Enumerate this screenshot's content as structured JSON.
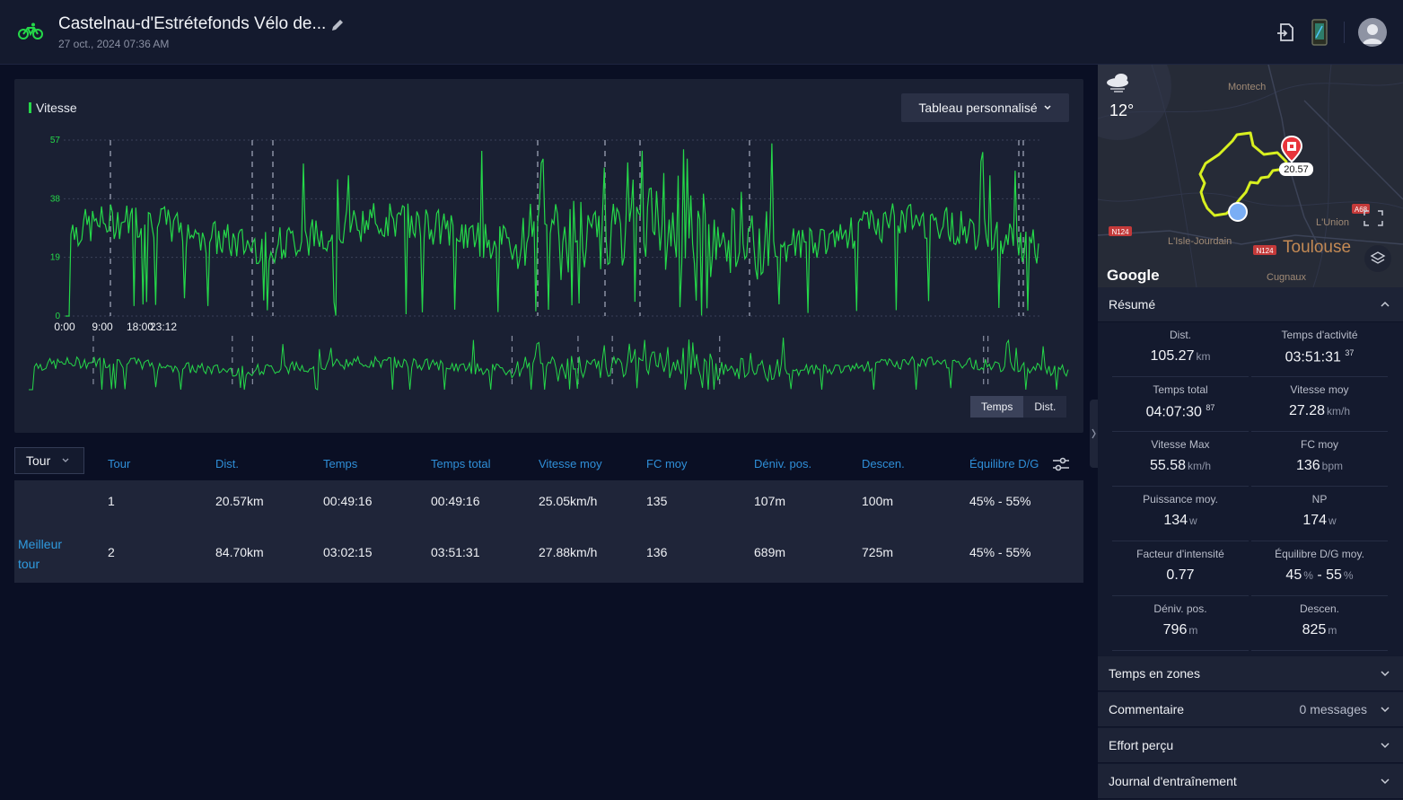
{
  "header": {
    "title": "Castelnau-d'Estrétefonds Vélo de...",
    "date": "27 oct., 2024 07:36 AM"
  },
  "chart": {
    "legend": "Vitesse",
    "custom_table_label": "Tableau personnalisé",
    "toggle": [
      "Temps",
      "Dist."
    ],
    "colors": {
      "line": "#25d849",
      "background": "#1a2033"
    }
  },
  "chart_data": {
    "type": "line",
    "series": [
      {
        "name": "Vitesse",
        "unit": "km/h"
      }
    ],
    "ylim": [
      0,
      57
    ],
    "yticks": [
      "57",
      "38",
      "19",
      "0"
    ],
    "xticks": [
      "0:00",
      "9:00",
      "18:00",
      "23:12"
    ],
    "grid": true,
    "legend_position": "top-left"
  },
  "laps": {
    "select_label": "Tour",
    "headers": [
      "Tour",
      "Dist.",
      "Temps",
      "Temps total",
      "Vitesse moy",
      "FC moy",
      "Déniv. pos.",
      "Descen.",
      "Équilibre D/G"
    ],
    "best_lap_label": "Meilleur tour",
    "rows": [
      [
        "1",
        "20.57km",
        "00:49:16",
        "00:49:16",
        "25.05km/h",
        "135",
        "107m",
        "100m",
        "45% - 55%"
      ],
      [
        "2",
        "84.70km",
        "03:02:15",
        "03:51:31",
        "27.88km/h",
        "136",
        "689m",
        "725m",
        "45% - 55%"
      ]
    ]
  },
  "map": {
    "temperature": "12°",
    "distance_marker": "20.57",
    "places": [
      "Montech",
      "L'Union",
      "L'Isle-Jourdain",
      "Toulouse",
      "Cugnaux"
    ],
    "roads": [
      "N124",
      "N124",
      "A68"
    ],
    "attribution": "Google"
  },
  "summary": {
    "title": "Résumé",
    "stats": [
      {
        "label": "Dist.",
        "value": "105.27",
        "unit": "km",
        "sup": ""
      },
      {
        "label": "Temps d'activité",
        "value": "03:51:31",
        "unit": "",
        "sup": "37"
      },
      {
        "label": "Temps total",
        "value": "04:07:30",
        "unit": "",
        "sup": "87"
      },
      {
        "label": "Vitesse moy",
        "value": "27.28",
        "unit": "km/h",
        "sup": ""
      },
      {
        "label": "Vitesse Max",
        "value": "55.58",
        "unit": "km/h",
        "sup": ""
      },
      {
        "label": "FC moy",
        "value": "136",
        "unit": "bpm",
        "sup": ""
      },
      {
        "label": "Puissance moy.",
        "value": "134",
        "unit": "w",
        "sup": ""
      },
      {
        "label": "NP",
        "value": "174",
        "unit": "w",
        "sup": ""
      },
      {
        "label": "Facteur d'intensité",
        "value": "0.77",
        "unit": "",
        "sup": ""
      },
      {
        "label": "Équilibre D/G moy.",
        "value": "45",
        "unit": "%",
        "value2": "55",
        "unit2": "%",
        "sup": ""
      },
      {
        "label": "Déniv. pos.",
        "value": "796",
        "unit": "m",
        "sup": ""
      },
      {
        "label": "Descen.",
        "value": "825",
        "unit": "m",
        "sup": ""
      }
    ]
  },
  "sections": [
    {
      "title": "Temps en zones",
      "right": ""
    },
    {
      "title": "Commentaire",
      "right": "0 messages"
    },
    {
      "title": "Effort perçu",
      "right": ""
    },
    {
      "title": "Journal d'entraînement",
      "right": ""
    }
  ]
}
